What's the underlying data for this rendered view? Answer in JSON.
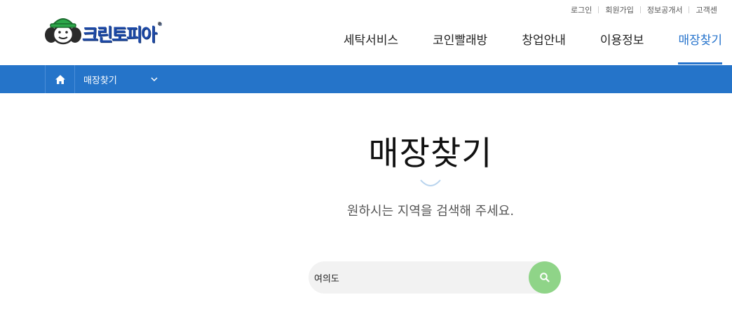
{
  "util_nav": [
    "로그인",
    "회원가입",
    "정보공개서",
    "고객센"
  ],
  "brand": {
    "name": "크린토피아",
    "registered": "®"
  },
  "gnb": [
    {
      "label": "세탁서비스",
      "active": false
    },
    {
      "label": "코인빨래방",
      "active": false
    },
    {
      "label": "창업안내",
      "active": false
    },
    {
      "label": "이용정보",
      "active": false
    },
    {
      "label": "매장찾기",
      "active": true
    }
  ],
  "breadcrumb": {
    "current": "매장찾기"
  },
  "page": {
    "title": "매장찾기",
    "subtitle": "원하시는 지역을 검색해 주세요."
  },
  "search": {
    "value": "여의도",
    "placeholder": ""
  },
  "colors": {
    "accent": "#2573cc",
    "bar": "#2574c9",
    "search_button": "#8fd488"
  },
  "icons": {
    "home": "home-icon",
    "chevron": "chevron-down-icon",
    "search": "search-icon"
  }
}
